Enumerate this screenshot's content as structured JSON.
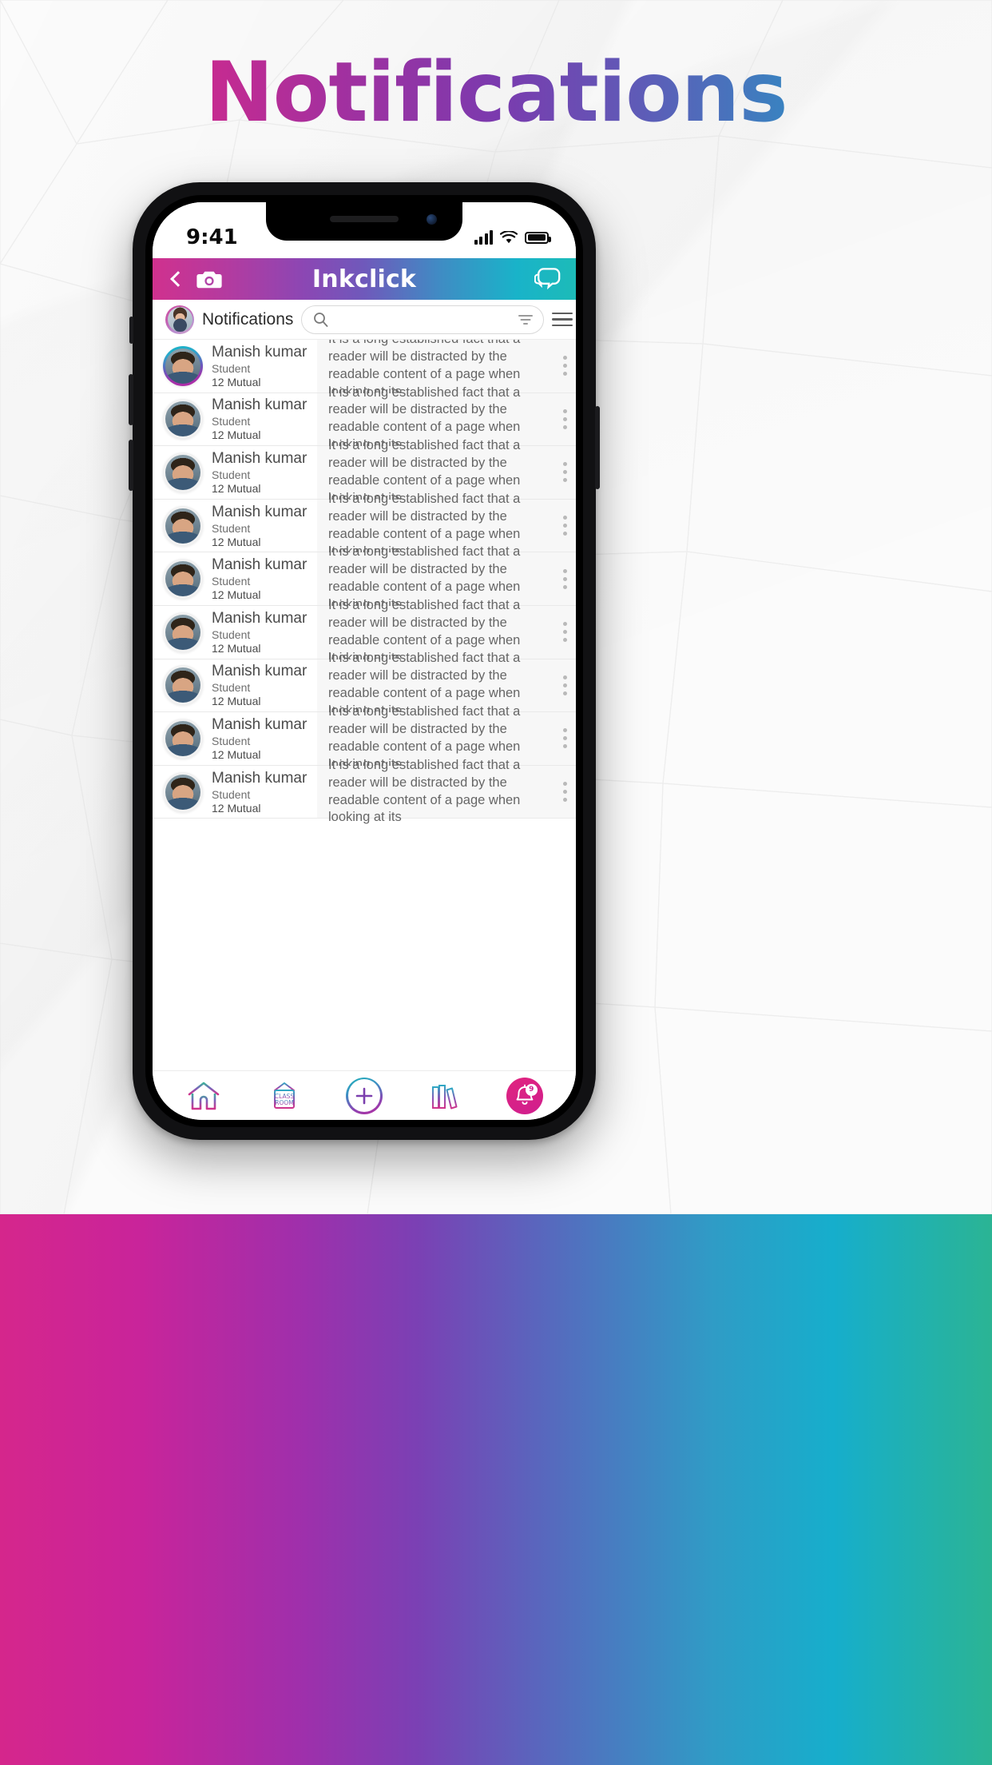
{
  "page": {
    "title": "Notifications",
    "title_gradient": [
      "#e8277e",
      "#7b3aae",
      "#1d9fc8"
    ],
    "bg_bottom_gradient": [
      "#d5268c",
      "#7b40b4",
      "#16aecc",
      "#2bb494"
    ]
  },
  "status_bar": {
    "time": "9:41",
    "signal_icon": "signal-bars-icon",
    "wifi_icon": "wifi-icon",
    "battery_icon": "battery-full-icon"
  },
  "app_bar": {
    "back_icon": "back-chevron-icon",
    "camera_icon": "camera-icon",
    "title": "Inkclick",
    "chat_icon": "chat-bubble-icon",
    "gradient": [
      "#d0318e",
      "#6f59bb",
      "#1dbbb8"
    ]
  },
  "search_row": {
    "avatar_icon": "user-avatar-icon",
    "label": "Notifications",
    "search_placeholder": "",
    "search_value": "",
    "search_icon": "search-icon",
    "filter_icon": "filter-icon",
    "menu_icon": "hamburger-menu-icon"
  },
  "notifications": [
    {
      "name": "Manish kumar",
      "role": "Student",
      "mutual": "12 Mutual",
      "message": "It is a long established fact that a reader will be distracted by the readable content of a page when looking at its",
      "active": true
    },
    {
      "name": "Manish kumar",
      "role": "Student",
      "mutual": "12 Mutual",
      "message": "It is a long established fact that a reader will be distracted by the readable content of a page when looking at its",
      "active": false
    },
    {
      "name": "Manish kumar",
      "role": "Student",
      "mutual": "12 Mutual",
      "message": "It is a long established fact that a reader will be distracted by the readable content of a page when looking at its",
      "active": false
    },
    {
      "name": "Manish kumar",
      "role": "Student",
      "mutual": "12 Mutual",
      "message": "It is a long established fact that a reader will be distracted by the readable content of a page when looking at its",
      "active": false
    },
    {
      "name": "Manish kumar",
      "role": "Student",
      "mutual": "12 Mutual",
      "message": "It is a long established fact that a reader will be distracted by the readable content of a page when looking at its",
      "active": false
    },
    {
      "name": "Manish kumar",
      "role": "Student",
      "mutual": "12 Mutual",
      "message": "It is a long established fact that a reader will be distracted by the readable content of a page when looking at its",
      "active": false
    },
    {
      "name": "Manish kumar",
      "role": "Student",
      "mutual": "12 Mutual",
      "message": "It is a long established fact that a reader will be distracted by the readable content of a page when looking at its",
      "active": false
    },
    {
      "name": "Manish kumar",
      "role": "Student",
      "mutual": "12 Mutual",
      "message": "It is a long established fact that a reader will be distracted by the readable content of a page when looking at its",
      "active": false
    },
    {
      "name": "Manish kumar",
      "role": "Student",
      "mutual": "12 Mutual",
      "message": "It is a long established fact that a reader will be distracted by the readable content of a page when looking at its",
      "active": false
    }
  ],
  "row_more_icon": "kebab-menu-icon",
  "bottom_nav": {
    "items": [
      {
        "icon": "home-icon",
        "label": "",
        "active": false
      },
      {
        "icon": "classroom-sign-icon",
        "label": "CLASS ROOM",
        "active": false
      },
      {
        "icon": "plus-icon",
        "label": "",
        "active": false
      },
      {
        "icon": "books-icon",
        "label": "",
        "active": false
      },
      {
        "icon": "bell-icon",
        "label": "",
        "active": true,
        "badge": "9"
      }
    ],
    "active_color": "#d01e8e"
  }
}
